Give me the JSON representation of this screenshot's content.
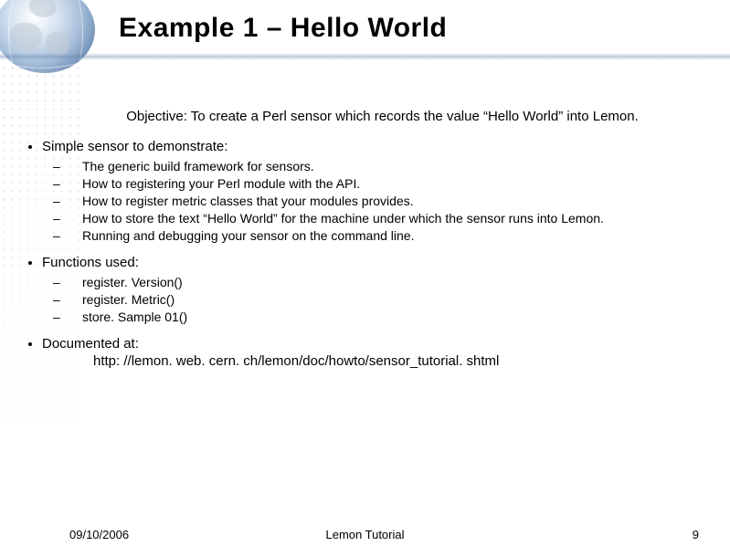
{
  "title": "Example 1 – Hello World",
  "objective": "Objective: To create a Perl sensor which records the value “Hello World” into Lemon.",
  "sections": {
    "simple": {
      "heading": "Simple sensor to demonstrate:",
      "items": [
        "The generic build framework for sensors.",
        "How to registering your Perl module with the API.",
        "How to register metric classes that your modules provides.",
        "How to store the text “Hello World” for the machine under which the sensor runs into Lemon.",
        "Running and debugging your sensor on the command line."
      ]
    },
    "functions": {
      "heading": "Functions used:",
      "items": [
        "register. Version()",
        "register. Metric()",
        "store. Sample 01()"
      ]
    },
    "documented": {
      "heading": "Documented at:",
      "link": "http: //lemon. web. cern. ch/lemon/doc/howto/sensor_tutorial. shtml"
    }
  },
  "footer": {
    "date": "09/10/2006",
    "center": "Lemon Tutorial",
    "page": "9"
  }
}
